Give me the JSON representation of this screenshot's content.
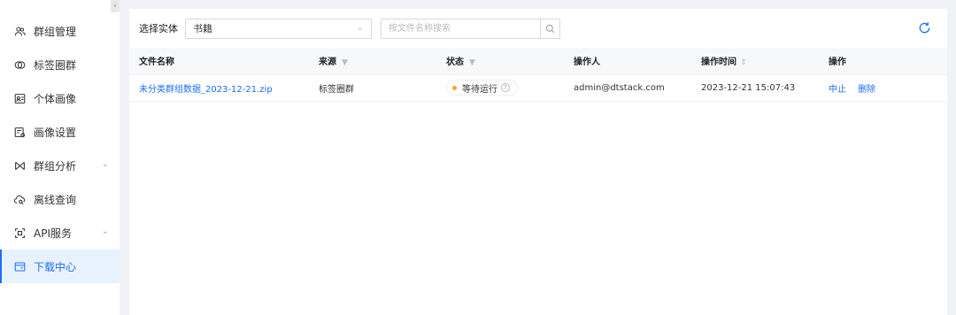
{
  "sidebar": {
    "collapse_glyph": "‹",
    "items": [
      {
        "label": "群组管理",
        "icon": "group-icon"
      },
      {
        "label": "标签圈群",
        "icon": "tag-circle-icon"
      },
      {
        "label": "个体画像",
        "icon": "portrait-icon"
      },
      {
        "label": "画像设置",
        "icon": "settings-icon"
      },
      {
        "label": "群组分析",
        "icon": "analysis-icon",
        "expandable": true
      },
      {
        "label": "离线查询",
        "icon": "cloud-search-icon"
      },
      {
        "label": "API服务",
        "icon": "api-icon",
        "expandable": true
      },
      {
        "label": "下载中心",
        "icon": "download-icon",
        "active": true
      }
    ]
  },
  "toolbar": {
    "entity_label": "选择实体",
    "entity_value": "书籍",
    "search_placeholder": "按文件名称搜索"
  },
  "table": {
    "columns": [
      "文件名称",
      "来源",
      "状态",
      "操作人",
      "操作时间",
      "操作"
    ],
    "rows": [
      {
        "file_name": "未分类群组数据_2023-12-21.zip",
        "source": "标签圈群",
        "status": "等待运行",
        "operator": "admin@dtstack.com",
        "time": "2023-12-21 15:07:43",
        "actions": [
          "中止",
          "删除"
        ]
      }
    ]
  },
  "colors": {
    "accent": "#1b6ef3",
    "status_waiting": "#f5a623",
    "active_bg": "#e8f2ff"
  }
}
